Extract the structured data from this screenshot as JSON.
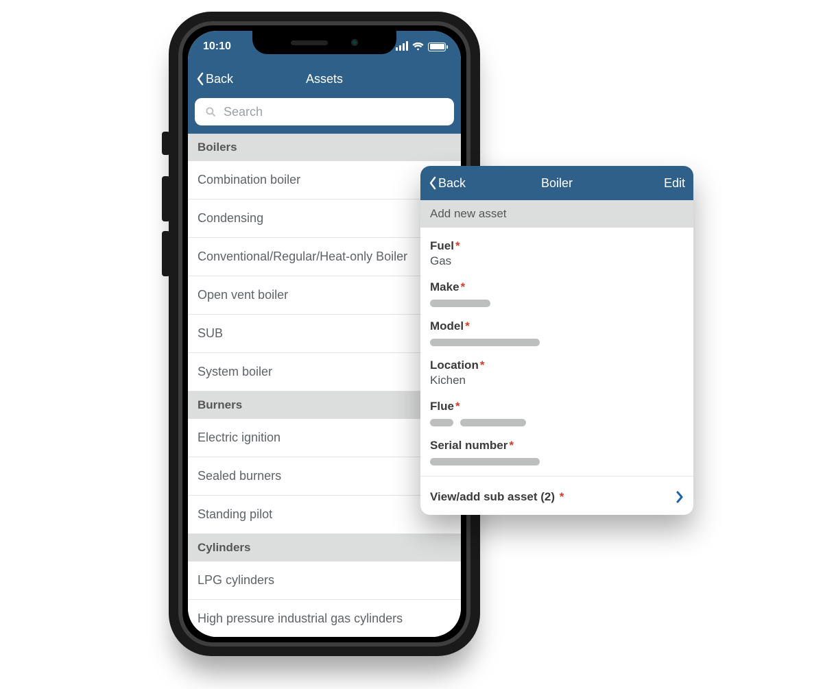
{
  "statusbar": {
    "time": "10:10"
  },
  "nav": {
    "back": "Back",
    "title": "Assets"
  },
  "search": {
    "placeholder": "Search"
  },
  "sections": [
    {
      "title": "Boilers",
      "items": [
        "Combination boiler",
        "Condensing",
        "Conventional/Regular/Heat-only Boiler",
        "Open vent boiler",
        "SUB",
        "System boiler"
      ]
    },
    {
      "title": "Burners",
      "items": [
        "Electric ignition",
        "Sealed burners",
        "Standing pilot"
      ]
    },
    {
      "title": "Cylinders",
      "items": [
        "LPG cylinders",
        "High pressure industrial gas cylinders"
      ]
    }
  ],
  "detail": {
    "nav": {
      "back": "Back",
      "title": "Boiler",
      "edit": "Edit"
    },
    "subheader": "Add new asset",
    "fields": {
      "fuel": {
        "label": "Fuel",
        "value": "Gas"
      },
      "make": {
        "label": "Make"
      },
      "model": {
        "label": "Model"
      },
      "location": {
        "label": "Location",
        "value": "Kichen"
      },
      "flue": {
        "label": "Flue"
      },
      "serial": {
        "label": "Serial number"
      }
    },
    "sub_asset_label": "View/add sub asset (2)"
  }
}
